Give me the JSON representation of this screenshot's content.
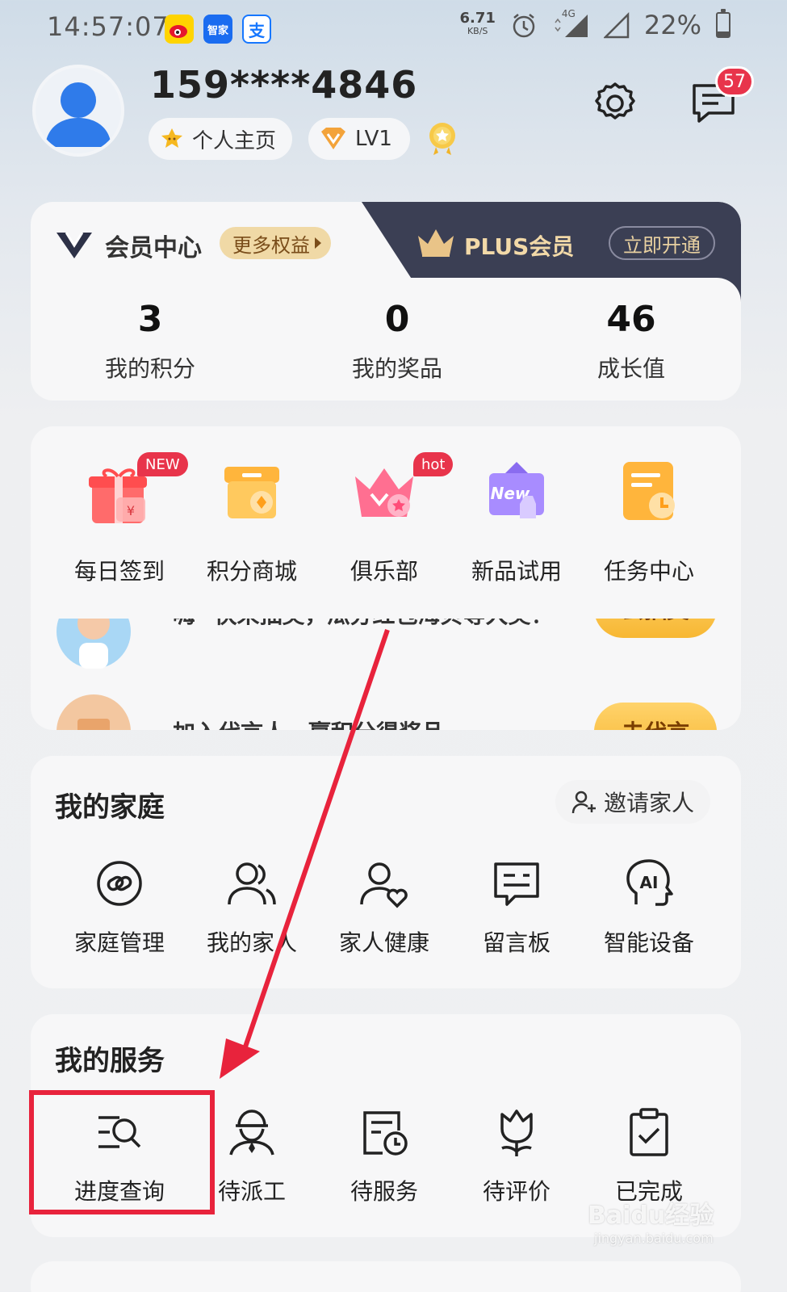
{
  "status_bar": {
    "time": "14:57:07",
    "apps": [
      "weibo-icon",
      "haier-smart-home-icon",
      "alipay-icon"
    ],
    "apps_text": {
      "smart_home": "智家",
      "pay": "支"
    },
    "net_speed_value": "6.71",
    "net_speed_unit": "KB/S",
    "network": "4G",
    "battery": "22%"
  },
  "profile": {
    "username": "159****4846",
    "homepage_label": "个人主页",
    "level_label": "LV1",
    "message_count": "57"
  },
  "member": {
    "title": "会员中心",
    "more_rights": "更多权益",
    "plus_title": "PLUS会员",
    "open_now": "立即开通",
    "stats": [
      {
        "value": "3",
        "label": "我的积分"
      },
      {
        "value": "0",
        "label": "我的奖品"
      },
      {
        "value": "46",
        "label": "成长值"
      }
    ]
  },
  "shortcuts": {
    "items": [
      {
        "label": "每日签到",
        "tag": "NEW",
        "icon": "gift-icon"
      },
      {
        "label": "积分商城",
        "tag": "",
        "icon": "shop-icon"
      },
      {
        "label": "俱乐部",
        "tag": "hot",
        "icon": "crown-club-icon"
      },
      {
        "label": "新品试用",
        "tag": "",
        "icon": "new-trial-icon"
      },
      {
        "label": "任务中心",
        "tag": "",
        "icon": "task-icon"
      }
    ],
    "promos": [
      {
        "text": "嗨~快来抽奖，瓜分红包海贝等大奖！",
        "button": "去抽奖"
      },
      {
        "text": "加入代言人，赢积分得奖品",
        "button": "去代言"
      }
    ]
  },
  "family": {
    "title": "我的家庭",
    "invite": "邀请家人",
    "items": [
      {
        "label": "家庭管理",
        "icon": "family-manage-icon"
      },
      {
        "label": "我的家人",
        "icon": "family-members-icon"
      },
      {
        "label": "家人健康",
        "icon": "family-health-icon"
      },
      {
        "label": "留言板",
        "icon": "message-board-icon"
      },
      {
        "label": "智能设备",
        "icon": "ai-device-icon"
      }
    ]
  },
  "services": {
    "title": "我的服务",
    "items": [
      {
        "label": "进度查询",
        "icon": "progress-search-icon"
      },
      {
        "label": "待派工",
        "icon": "worker-icon"
      },
      {
        "label": "待服务",
        "icon": "pending-service-icon"
      },
      {
        "label": "待评价",
        "icon": "review-flower-icon"
      },
      {
        "label": "已完成",
        "icon": "completed-clipboard-icon"
      }
    ]
  },
  "watermark": {
    "brand": "Baidu经验",
    "url": "jingyan.baidu.com"
  },
  "colors": {
    "accent_red": "#e8344b",
    "gold": "#f0d9a6",
    "plus_dark": "#3b3f54"
  }
}
